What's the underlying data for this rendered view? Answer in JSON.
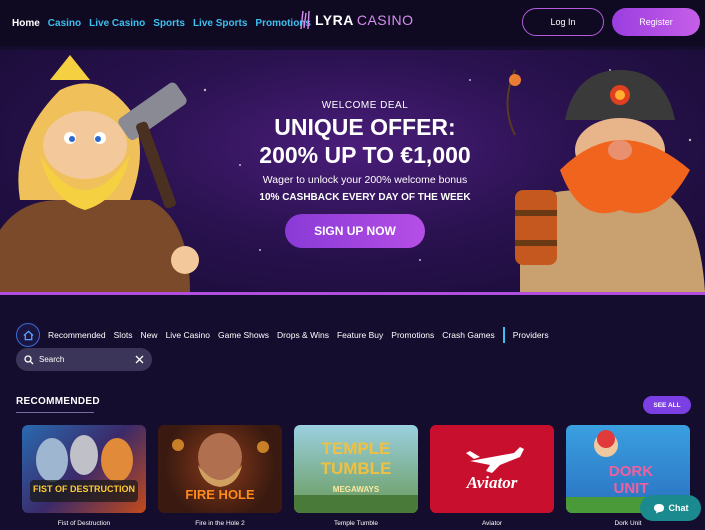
{
  "nav": {
    "items": [
      {
        "label": "Home"
      },
      {
        "label": "Casino"
      },
      {
        "label": "Live Casino"
      },
      {
        "label": "Sports"
      },
      {
        "label": "Live Sports"
      },
      {
        "label": "Promotions"
      }
    ],
    "logo_left": "LYRA",
    "logo_right": "CASINO",
    "login_label": "Log In",
    "register_label": "Register"
  },
  "hero": {
    "kicker": "WELCOME DEAL",
    "title_line1": "UNIQUE OFFER:",
    "title_line2": "200% UP TO €1,000",
    "subtitle": "Wager to unlock your 200% welcome bonus",
    "cashback": "10% CASHBACK EVERY DAY OF THE WEEK",
    "cta_label": "SIGN UP NOW"
  },
  "categories": {
    "items": [
      {
        "label": "Recommended"
      },
      {
        "label": "Slots"
      },
      {
        "label": "New"
      },
      {
        "label": "Live Casino"
      },
      {
        "label": "Game Shows"
      },
      {
        "label": "Drops & Wins"
      },
      {
        "label": "Feature Buy"
      },
      {
        "label": "Promotions"
      },
      {
        "label": "Crash Games"
      }
    ],
    "providers_label": "Providers"
  },
  "search": {
    "placeholder": "Search"
  },
  "recommended": {
    "title": "RECOMMENDED",
    "see_all_label": "SEE ALL",
    "games": [
      {
        "title": "Fist of Destruction",
        "logo_text": "FIST OF DESTRUCTION"
      },
      {
        "title": "Fire in the Hole 2",
        "logo_text": "FIRE HOLE"
      },
      {
        "title": "Temple Tumble",
        "logo_text": "TEMPLE TUMBLE",
        "logo_sub": "MEGAWAYS"
      },
      {
        "title": "Aviator",
        "logo_text": "Aviator"
      },
      {
        "title": "Dork Unit",
        "logo_text": "DORK UNIT"
      }
    ]
  },
  "chat": {
    "label": "Chat"
  },
  "colors": {
    "accent_purple": "#b04ee0",
    "nav_link": "#3cc0f0",
    "background": "#150d2e"
  }
}
